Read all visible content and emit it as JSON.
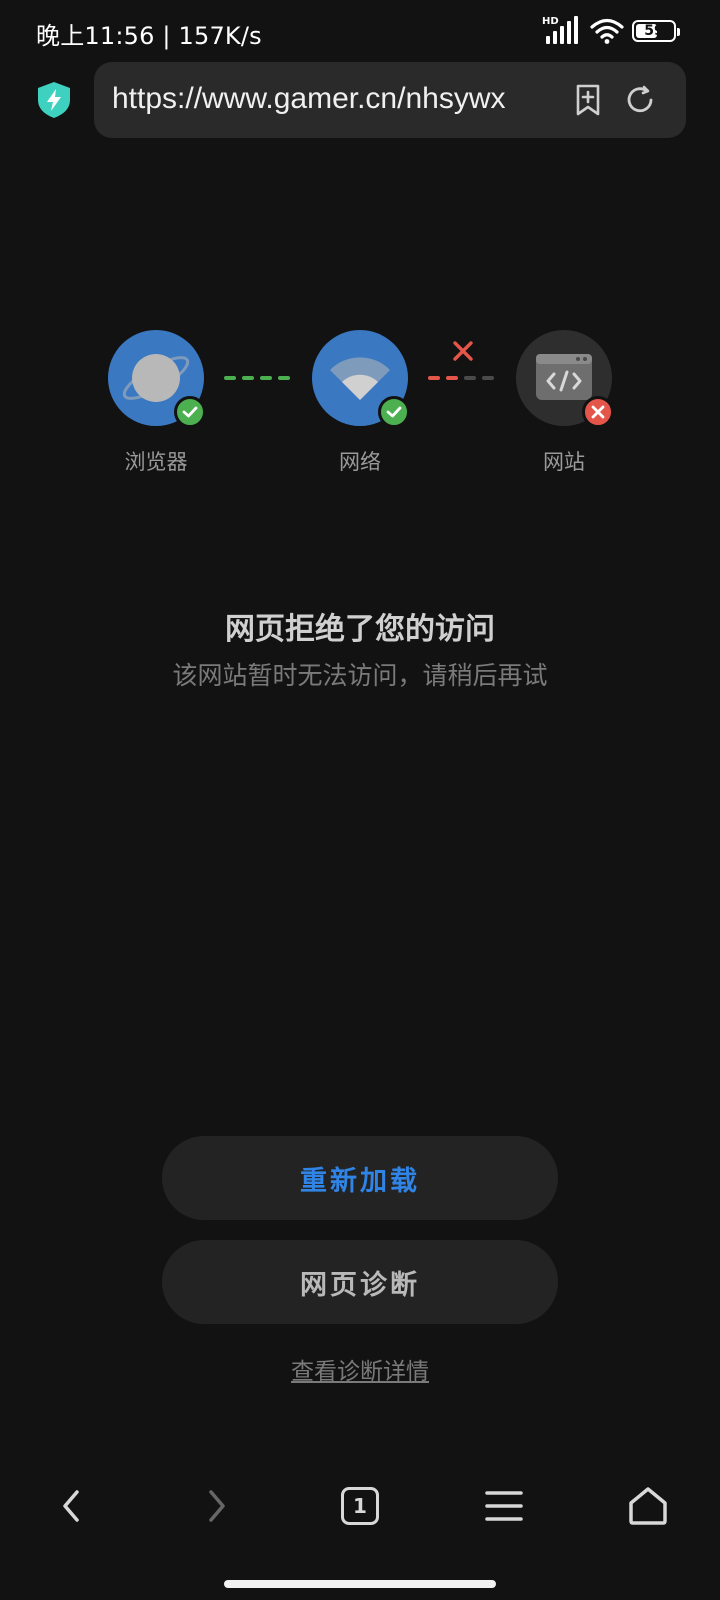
{
  "status_bar": {
    "time_speed": "晚上11:56 | 157K/s",
    "signal_label": "HD",
    "battery": "59",
    "battery_level": 0.59
  },
  "address_bar": {
    "url": "https://www.gamer.cn/nhsywx"
  },
  "diagram": {
    "nodes": [
      {
        "label": "浏览器",
        "status": "ok"
      },
      {
        "label": "网络",
        "status": "ok"
      },
      {
        "label": "网站",
        "status": "error"
      }
    ]
  },
  "error": {
    "title": "网页拒绝了您的访问",
    "subtitle": "该网站暂时无法访问，请稍后再试"
  },
  "actions": {
    "reload_label": "重新加载",
    "diagnose_label": "网页诊断",
    "details_link": "查看诊断详情"
  },
  "bottom_nav": {
    "tab_count": "1"
  },
  "colors": {
    "background": "#121212",
    "accent_blue": "#2f84e6",
    "node_blue": "#3a78c2",
    "ok_green": "#4caf50",
    "error_red": "#e5564a",
    "shield_teal": "#3fd1c0"
  }
}
